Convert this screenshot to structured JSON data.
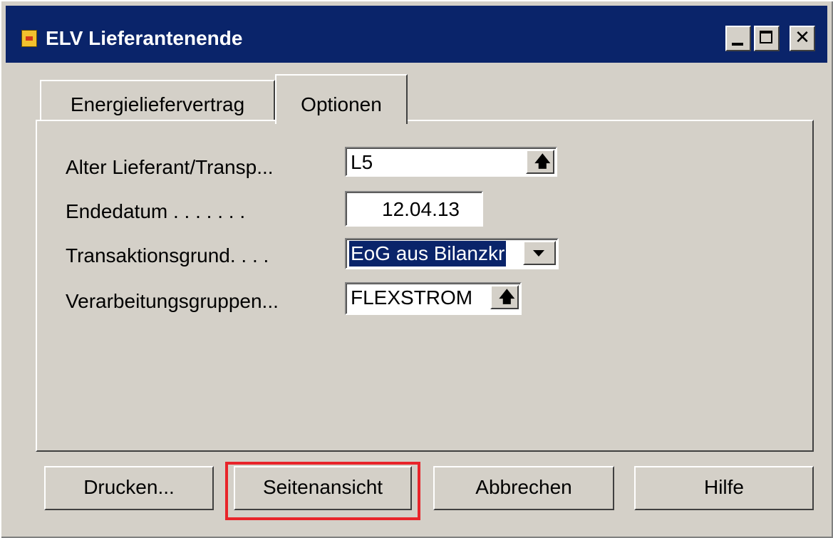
{
  "window": {
    "title": "ELV Lieferantenende",
    "icon": "form-icon"
  },
  "tabs": [
    {
      "label": "Energieliefervertrag",
      "active": false
    },
    {
      "label": "Optionen",
      "active": true
    }
  ],
  "fields": {
    "alter_lieferant": {
      "label": "Alter Lieferant/Transp...",
      "value": "L5",
      "button_icon": "lookup-arrow-icon"
    },
    "endedatum": {
      "label": "Endedatum . . . . . . .",
      "value": "12.04.13"
    },
    "transaktionsgrund": {
      "label": "Transaktionsgrund. . . .",
      "value": "EoG aus Bilanzkr",
      "button_icon": "dropdown-arrow-icon"
    },
    "verarbeitungsgruppen": {
      "label": "Verarbeitungsgruppen...",
      "value": "FLEXSTROM",
      "button_icon": "lookup-arrow-icon"
    }
  },
  "buttons": {
    "drucken": "Drucken...",
    "seitenansicht": "Seitenansicht",
    "abbrechen": "Abbrechen",
    "hilfe": "Hilfe"
  },
  "highlight_color": "#e8242a"
}
